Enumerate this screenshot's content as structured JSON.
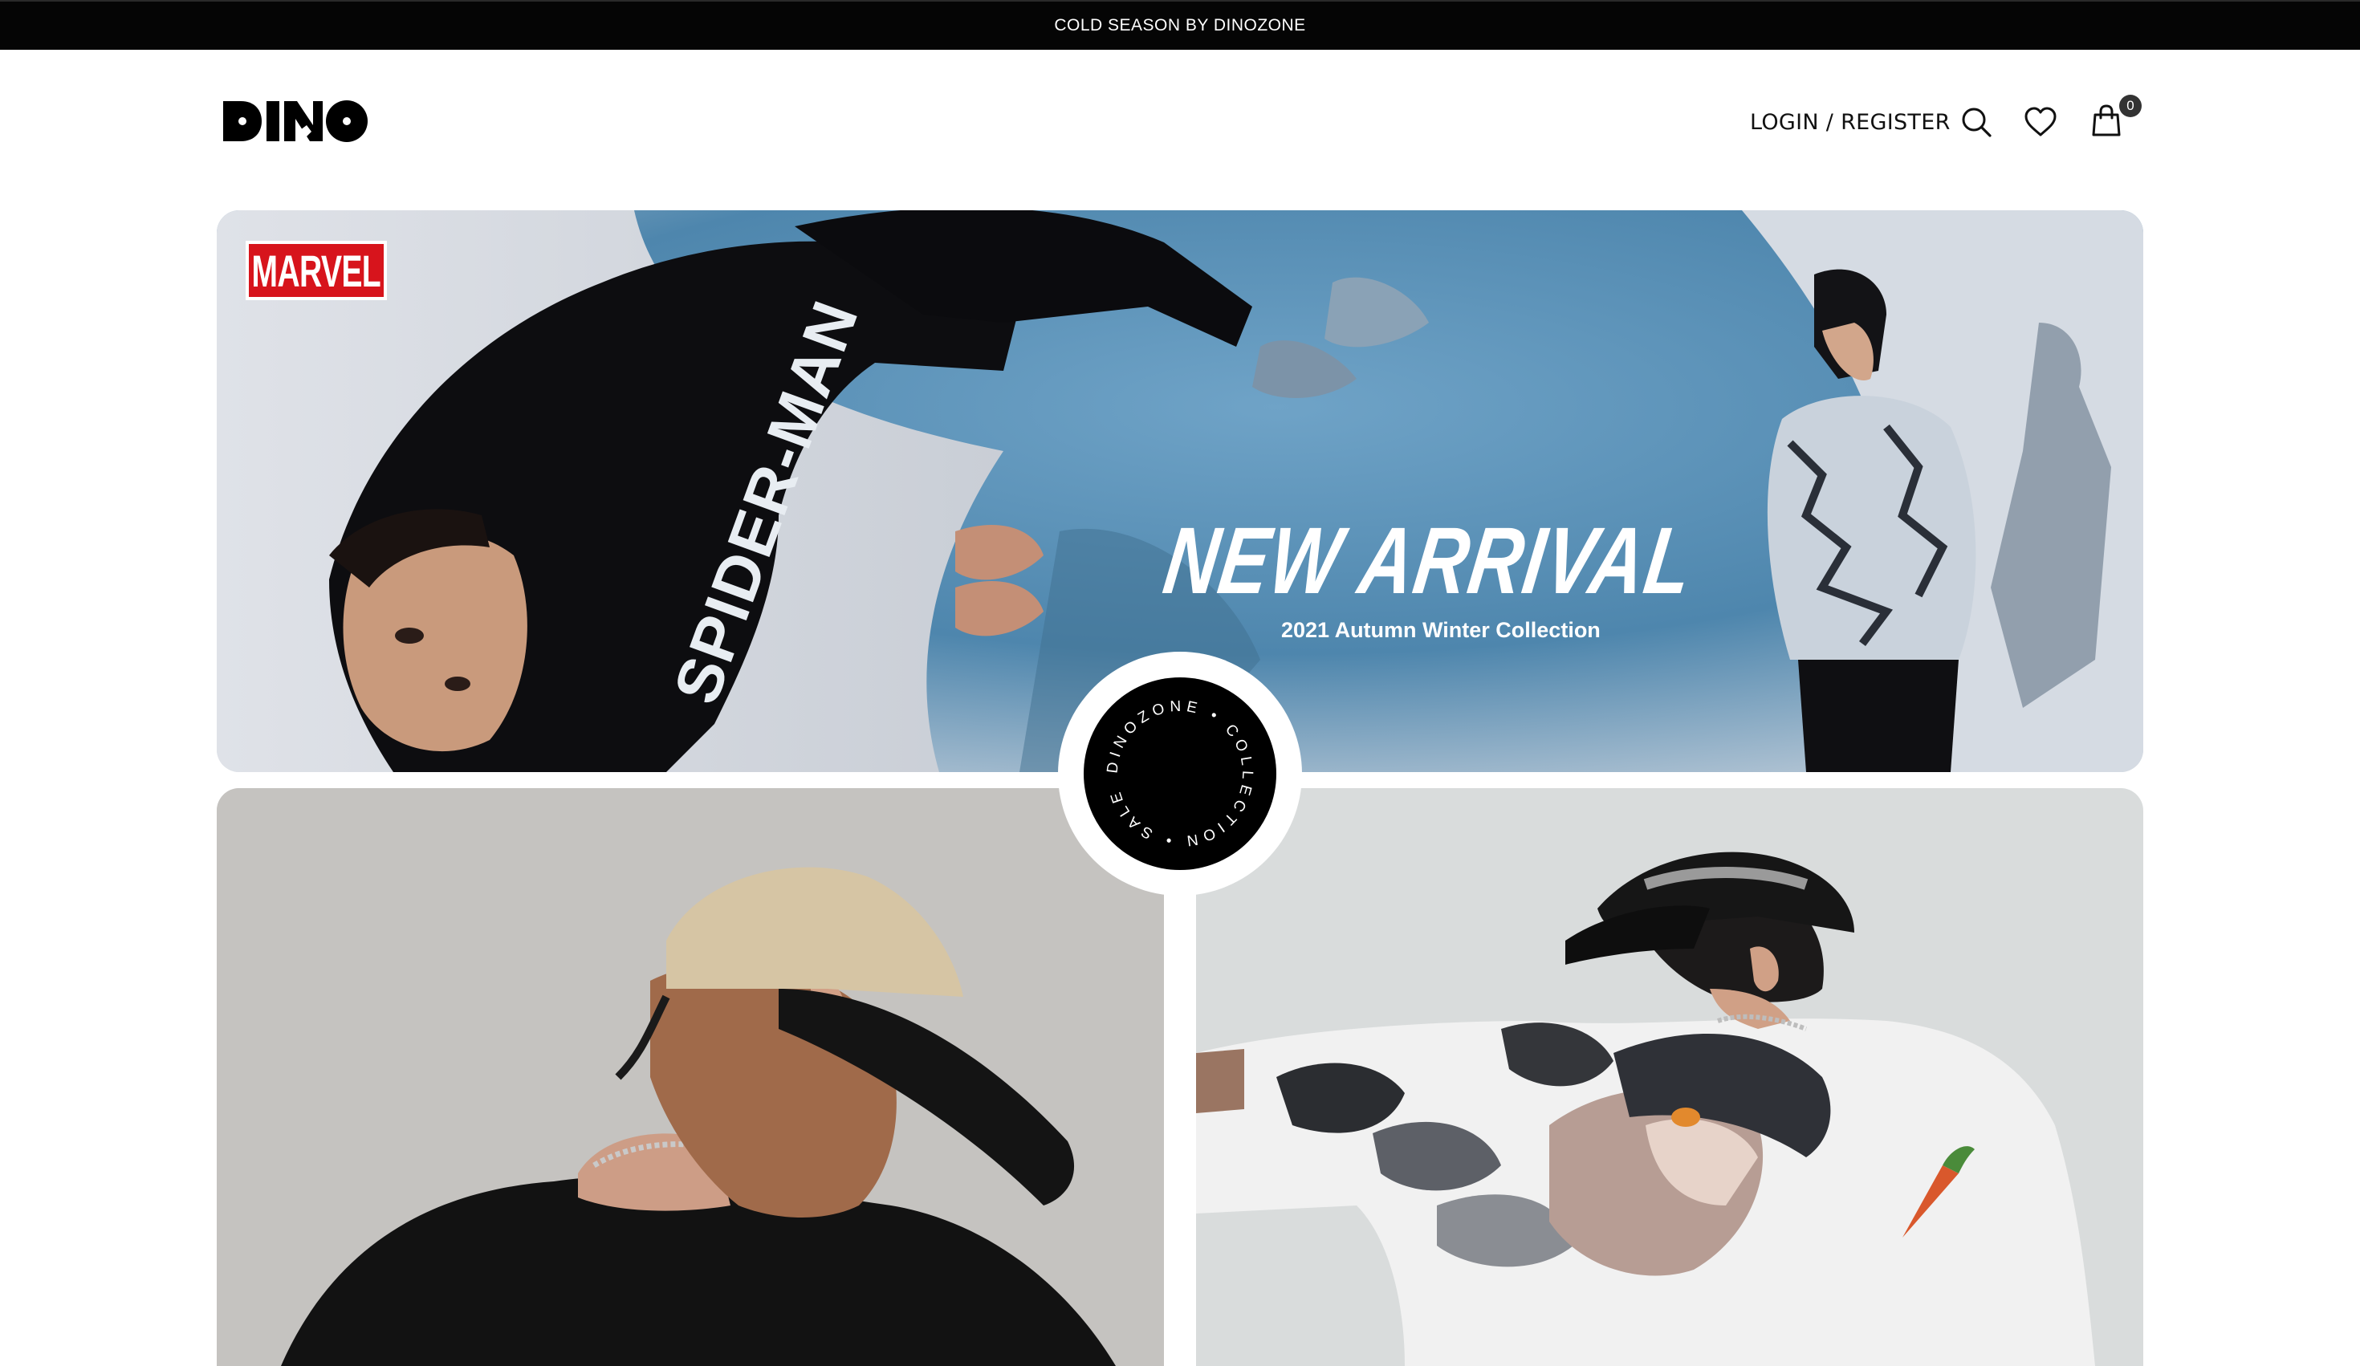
{
  "announcement": {
    "text": "COLD SEASON BY DINOZONE"
  },
  "header": {
    "logo_text": "DINO",
    "login_label": "LOGIN / REGISTER",
    "cart_count": "0",
    "icons": [
      "search-icon",
      "heart-icon",
      "shopping-bag-icon"
    ]
  },
  "hero": {
    "brand": "MARVEL",
    "garment_print": "SPIDER-MAN",
    "title": "NEW ARRIVAL",
    "subtitle": "2021 Autumn Winter Collection"
  },
  "badge": {
    "ring_text": "DINOZONE • COLLECTION • SALE • "
  },
  "colors": {
    "announcement_bg": "#050505",
    "text_dark": "#111111",
    "hero_blue": "#5f97bd",
    "badge_bg": "#000000"
  }
}
